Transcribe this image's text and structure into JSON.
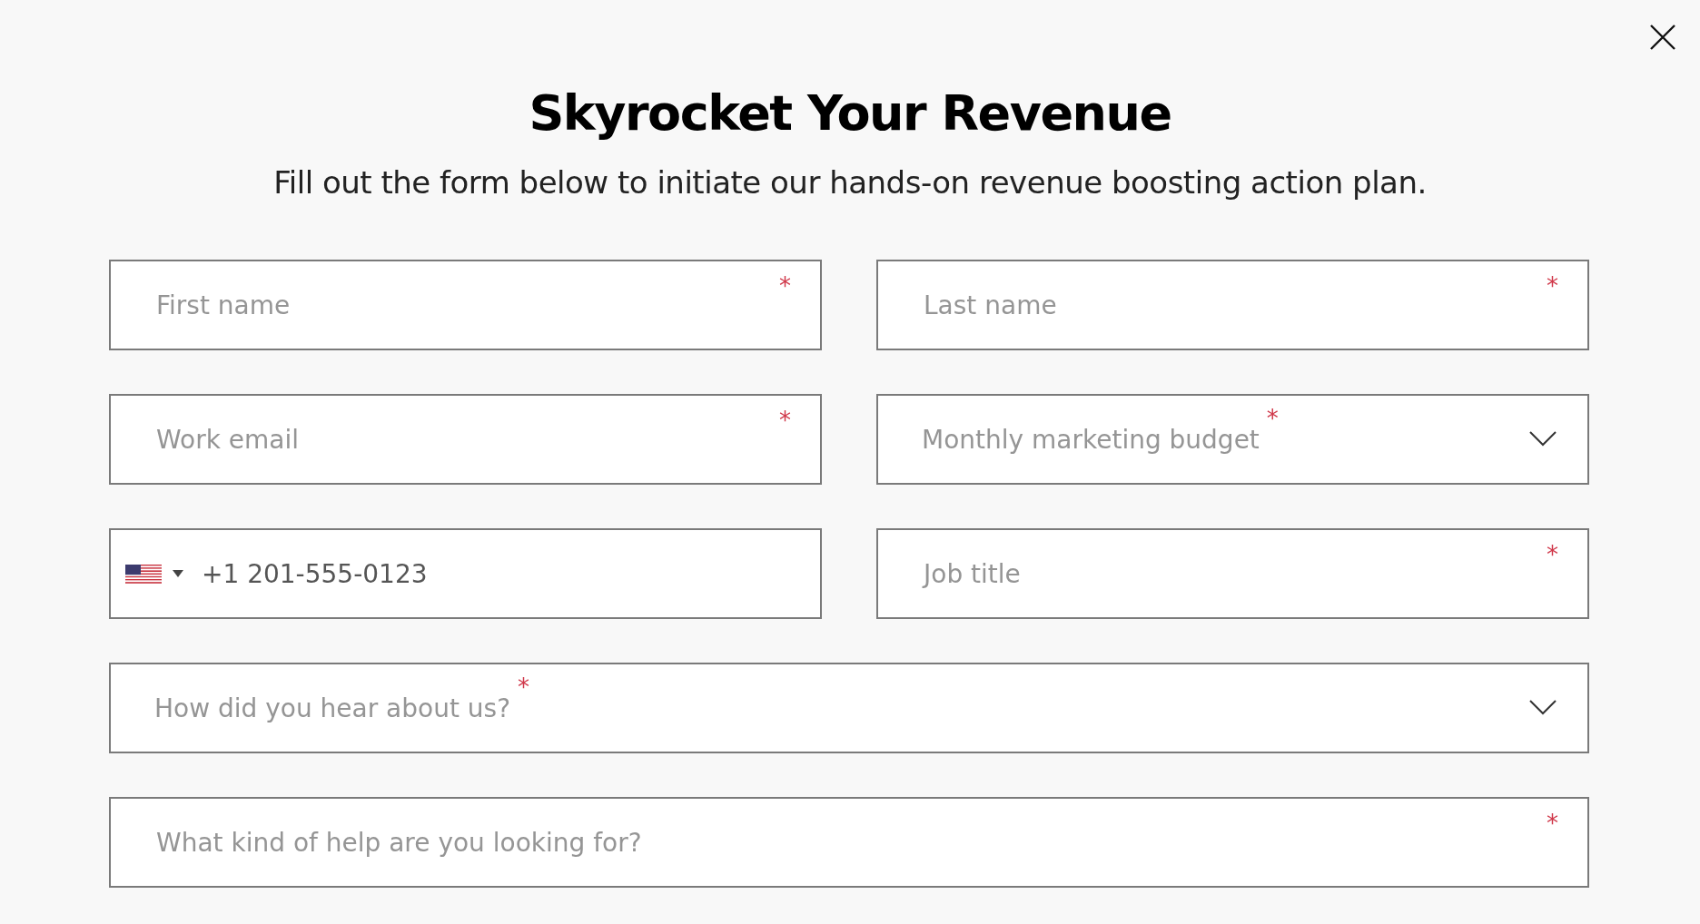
{
  "dialog": {
    "title": "Skyrocket Your Revenue",
    "subtitle": "Fill out the form below to initiate our hands-on revenue boosting action plan."
  },
  "rows": [
    [
      {
        "kind": "text",
        "placeholder": "First name",
        "required_mark": "*"
      },
      {
        "kind": "text",
        "placeholder": "Last name",
        "required_mark": "*"
      }
    ],
    [
      {
        "kind": "text",
        "placeholder": "Work email",
        "required_mark": "*"
      },
      {
        "kind": "select",
        "placeholder": "Monthly marketing budget",
        "required_mark": "*"
      }
    ],
    [
      {
        "kind": "phone",
        "value": "+1 201-555-0123"
      },
      {
        "kind": "text",
        "placeholder": "Job title",
        "required_mark": "*"
      }
    ],
    [
      {
        "kind": "select",
        "placeholder": "How did you hear about us?",
        "required_mark": "*"
      }
    ],
    [
      {
        "kind": "text",
        "placeholder": "What kind of help are you looking for?",
        "required_mark": "*"
      }
    ]
  ]
}
